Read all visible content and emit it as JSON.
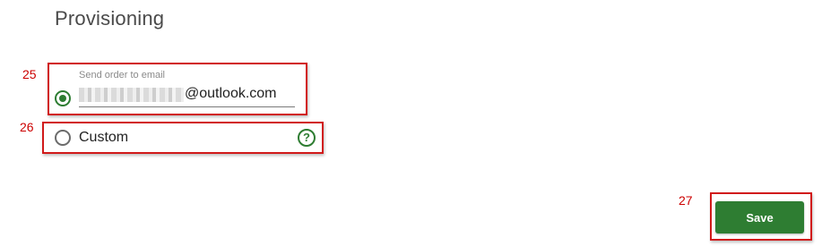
{
  "page": {
    "title": "Provisioning"
  },
  "annotations": {
    "n25": "25",
    "n26": "26",
    "n27": "27"
  },
  "provisioning": {
    "email_option": {
      "label": "Send order to email",
      "value_domain": "@outlook.com",
      "selected": true
    },
    "custom_option": {
      "label": "Custom",
      "selected": false,
      "help_icon": "question-circle-icon",
      "help_glyph": "?"
    }
  },
  "actions": {
    "save_label": "Save"
  },
  "colors": {
    "accent": "#2e7d32",
    "annotation": "#d11a1a"
  }
}
